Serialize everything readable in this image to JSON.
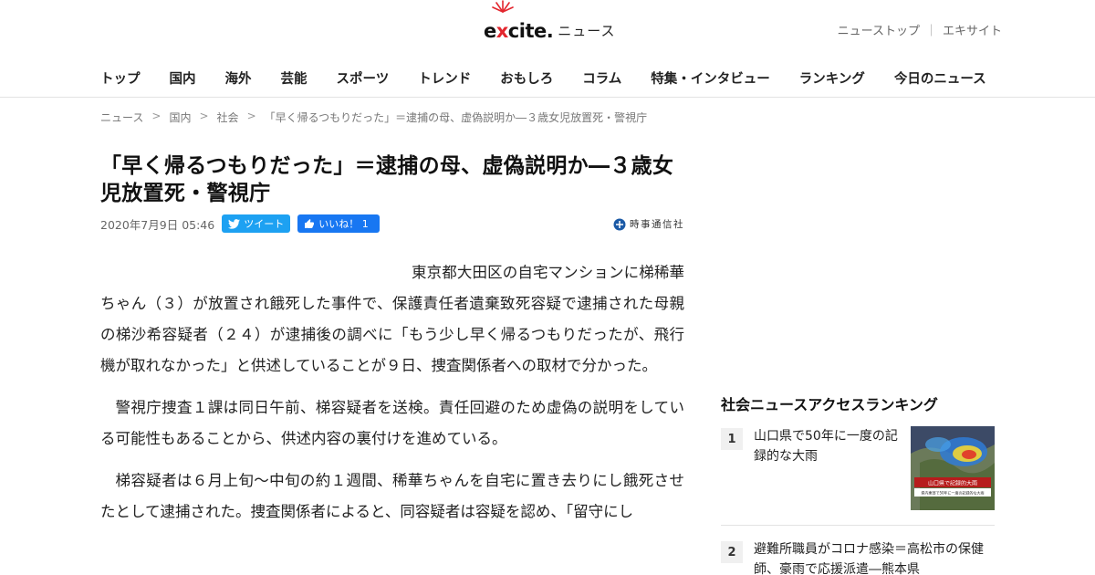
{
  "header": {
    "logo_text_pre": "e",
    "logo_text_x": "x",
    "logo_text_post": "cite",
    "logo_dot": ".",
    "logo_news": "ニュース",
    "top_links": [
      "ニューストップ",
      "エキサイト"
    ],
    "top_links_sep": "｜"
  },
  "nav": {
    "items": [
      "トップ",
      "国内",
      "海外",
      "芸能",
      "スポーツ",
      "トレンド",
      "おもしろ",
      "コラム",
      "特集・インタビュー",
      "ランキング",
      "今日のニュース"
    ]
  },
  "breadcrumb": {
    "items": [
      "ニュース",
      "国内",
      "社会",
      "「早く帰るつもりだった」＝逮捕の母、虚偽説明か―３歳女児放置死・警視庁"
    ],
    "sep": ">"
  },
  "article": {
    "title": "「早く帰るつもりだった」＝逮捕の母、虚偽説明か―３歳女児放置死・警視庁",
    "date": "2020年7月9日 05:46",
    "tweet_label": "ツイート",
    "like_label": "いいね！ 1",
    "source": "時事通信社",
    "paragraphs": [
      "東京都大田区の自宅マンションに梯稀華ちゃん（３）が放置され餓死した事件で、保護責任者遺棄致死容疑で逮捕された母親の梯沙希容疑者（２４）が逮捕後の調べに「もう少し早く帰るつもりだったが、飛行機が取れなかった」と供述していることが９日、捜査関係者への取材で分かった。",
      "警視庁捜査１課は同日午前、梯容疑者を送検。責任回避のため虚偽の説明をしている可能性もあることから、供述内容の裏付けを進めている。",
      "梯容疑者は６月上旬〜中旬の約１週間、稀華ちゃんを自宅に置き去りにし餓死させたとして逮捕された。捜査関係者によると、同容疑者は容疑を認め、「留守にし"
    ]
  },
  "sidebar": {
    "ranking_title": "社会ニュースアクセスランキング",
    "items": [
      {
        "rank": "1",
        "text": "山口県で50年に一度の記録的な大雨",
        "thumb_caption": "山口県で記録的大雨",
        "thumb_sub": "県内東部で50年に一度の記録的な大雨"
      },
      {
        "rank": "2",
        "text": "避難所職員がコロナ感染＝高松市の保健師、豪雨で応援派遣―熊本県"
      }
    ]
  },
  "colors": {
    "twitter": "#1da1f2",
    "facebook": "#1877f2",
    "logo_red": "#e3262e"
  }
}
